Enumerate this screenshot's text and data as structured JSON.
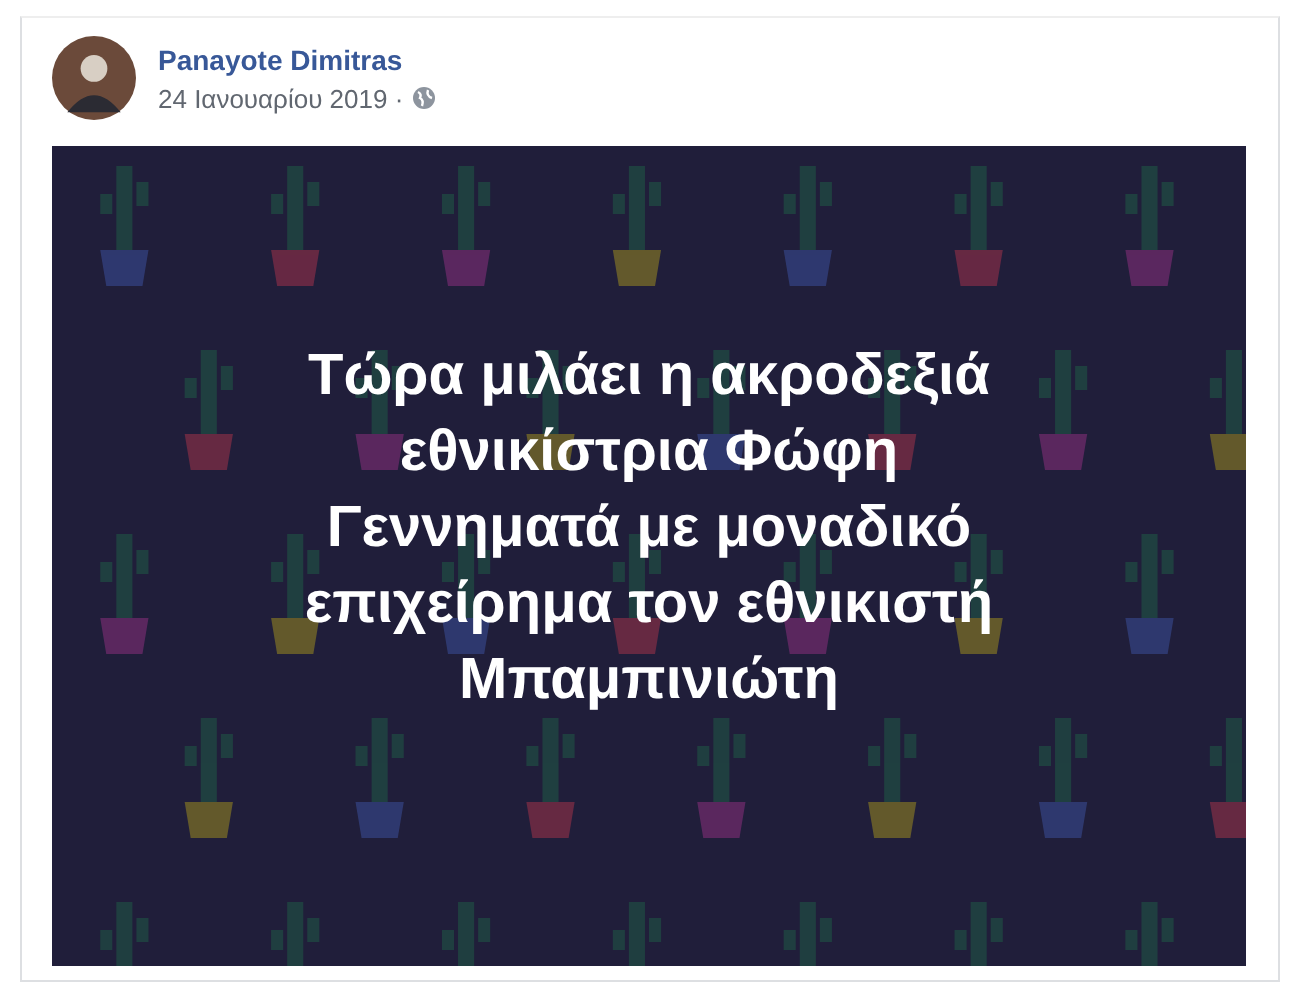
{
  "post": {
    "author": "Panayote Dimitras",
    "date": "24 Ιανουαρίου 2019 ·",
    "text_lines": [
      "Τώρα μιλάει η ακροδεξιά",
      "εθνικίστρια Φώφη",
      "Γεννηματά με μοναδικό",
      "επιχείρημα τον εθνικιστή",
      "Μπαμπινιώτη"
    ]
  }
}
